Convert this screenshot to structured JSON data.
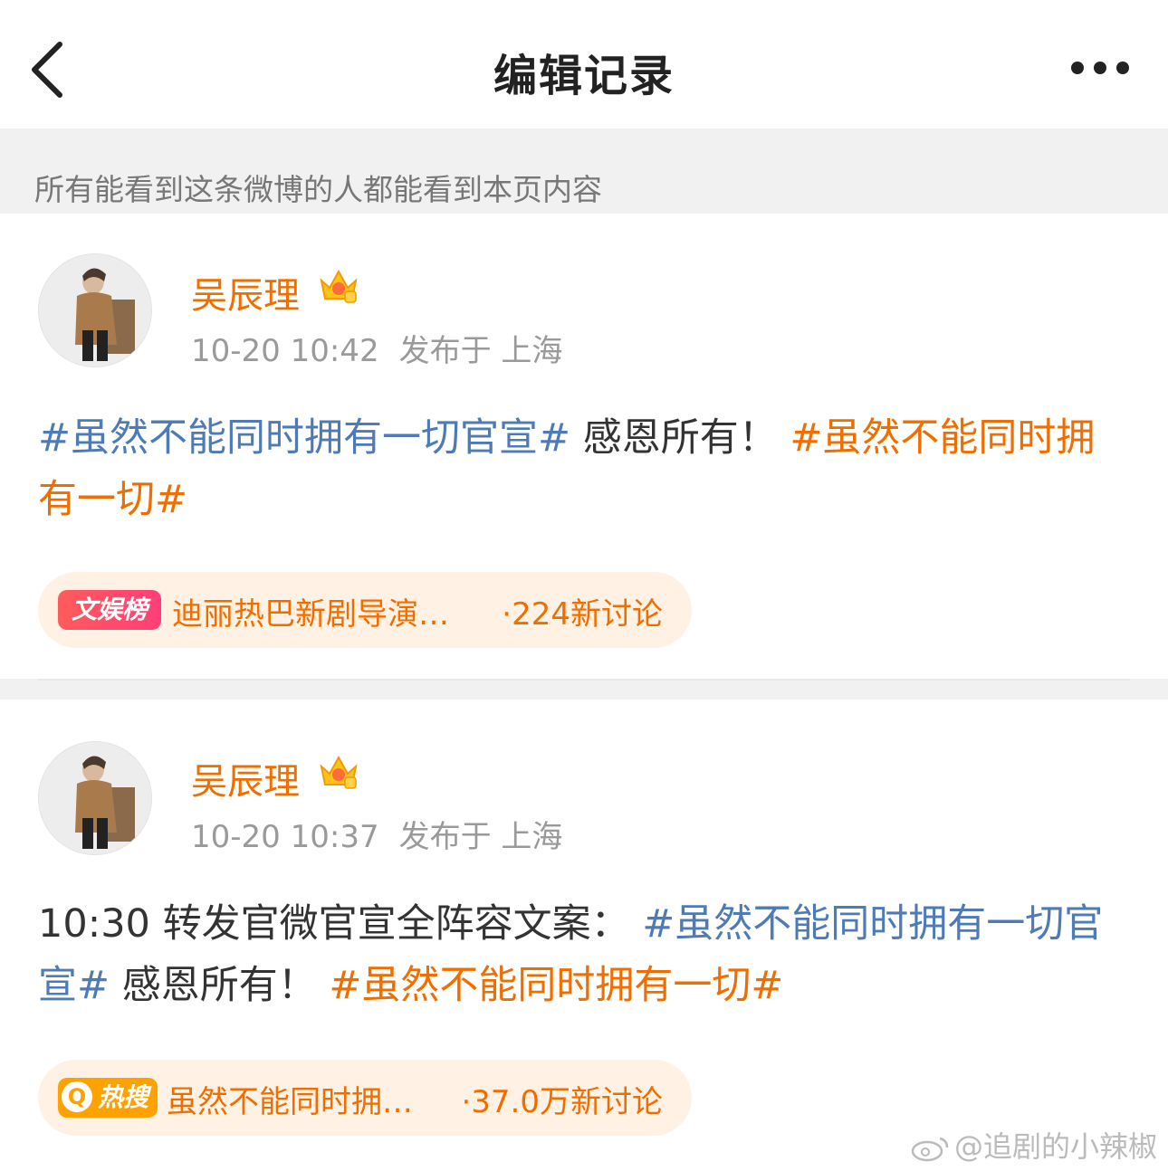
{
  "nav": {
    "title": "编辑记录"
  },
  "notice": "所有能看到这条微博的人都能看到本页内容",
  "posts": [
    {
      "user_name": "吴辰理",
      "time": "10-20 10:42",
      "location": "发布于 上海",
      "text": [
        {
          "t": "#虽然不能同时拥有一切官宣#",
          "style": "topic-blue"
        },
        {
          "t": " 感恩所有！ ",
          "style": "plain"
        },
        {
          "t": "#虽然不能同时拥有一切#",
          "style": "topic-orange"
        }
      ],
      "trend": {
        "badge": "文娱榜",
        "label": "迪丽热巴新剧导演…",
        "count": "·224新讨论"
      }
    },
    {
      "user_name": "吴辰理",
      "time": "10-20 10:37",
      "location": "发布于 上海",
      "text": [
        {
          "t": "10:30 转发官微官宣全阵容文案： ",
          "style": "plain"
        },
        {
          "t": "#虽然不能同时拥有一切官宣#",
          "style": "topic-blue"
        },
        {
          "t": " 感恩所有！ ",
          "style": "plain"
        },
        {
          "t": "#虽然不能同时拥有一切#",
          "style": "topic-orange"
        }
      ],
      "trend": {
        "badge": "热搜",
        "label": "虽然不能同时拥…",
        "count": "·37.0万新讨论"
      }
    }
  ],
  "watermark": "@追剧的小辣椒",
  "icons": {
    "back": "chevron-left-icon",
    "more": "more-dots-icon",
    "crown": "crown-badge-icon",
    "search": "search-icon",
    "weibo": "weibo-logo-icon"
  },
  "colors": {
    "accent": "#f06e00",
    "topic": "#4e7bb5",
    "pill_bg": "#fff1e4"
  }
}
